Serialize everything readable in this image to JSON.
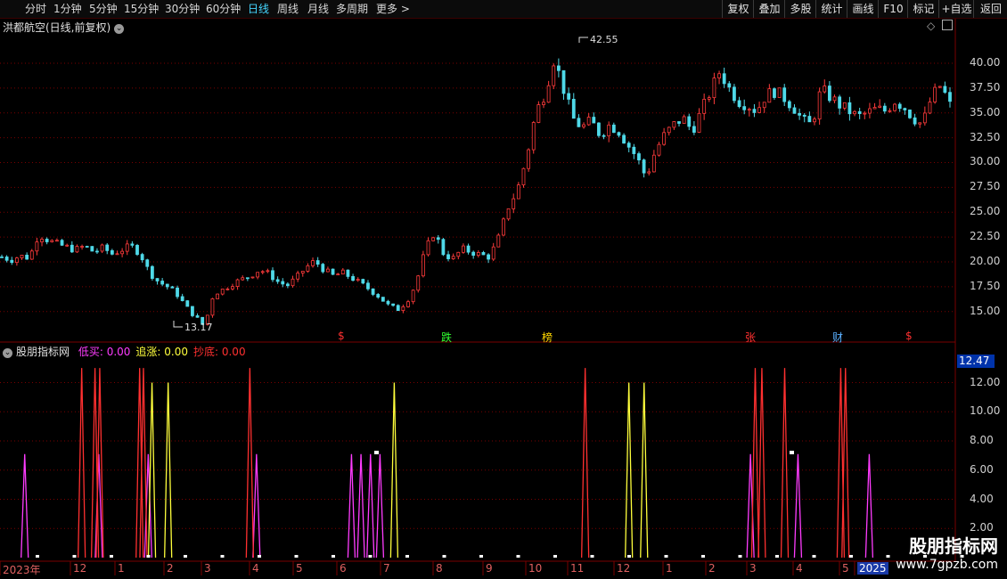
{
  "toolbar": {
    "periods": [
      {
        "label": "分时",
        "active": false
      },
      {
        "label": "1分钟",
        "active": false
      },
      {
        "label": "5分钟",
        "active": false
      },
      {
        "label": "15分钟",
        "active": false
      },
      {
        "label": "30分钟",
        "active": false
      },
      {
        "label": "60分钟",
        "active": false
      },
      {
        "label": "日线",
        "active": true
      },
      {
        "label": "周线",
        "active": false
      },
      {
        "label": "月线",
        "active": false
      },
      {
        "label": "多周期",
        "active": false
      }
    ],
    "more_label": "更多",
    "more_arrow": ">",
    "buttons": [
      "复权",
      "叠加",
      "多股",
      "统计",
      "画线",
      "F10",
      "标记",
      "+自选",
      "返回"
    ]
  },
  "main": {
    "title": "洪都航空(日线,前复权)",
    "high_label": "42.55",
    "low_label": "13.17",
    "yaxis_ticks": [
      "40.00",
      "37.50",
      "35.00",
      "32.50",
      "30.00",
      "27.50",
      "25.00",
      "22.50",
      "20.00",
      "17.50",
      "15.00"
    ],
    "markers": [
      {
        "text": "$",
        "color": "#ff3030"
      },
      {
        "text": "跌",
        "color": "#30ff30"
      },
      {
        "text": "榜",
        "color": "#ffd700"
      },
      {
        "text": "张",
        "color": "#ff3030"
      },
      {
        "text": "财",
        "color": "#5ab0ff"
      },
      {
        "text": "$",
        "color": "#ff3030"
      }
    ]
  },
  "indicator": {
    "name": "股朋指标网",
    "items": [
      {
        "label": "低买:",
        "value": "0.00",
        "color": "#ff3cff"
      },
      {
        "label": "追涨:",
        "value": "0.00",
        "color": "#ffff3c"
      },
      {
        "label": "抄底:",
        "value": "0.00",
        "color": "#ff3030"
      }
    ],
    "current_value": "12.47",
    "yaxis_ticks": [
      "12.00",
      "10.00",
      "8.00",
      "6.00",
      "4.00",
      "2.00"
    ]
  },
  "xaxis": {
    "labels": [
      "2023年",
      "12",
      "1",
      "2",
      "3",
      "4",
      "5",
      "6",
      "7",
      "8",
      "9",
      "10",
      "11",
      "12",
      "1",
      "2",
      "3",
      "4",
      "5",
      "2025"
    ]
  },
  "watermark": {
    "title": "股朋指标网",
    "url": "www.7gpzb.com"
  },
  "colors": {
    "up": "#ff3b3b",
    "down": "#4fd9e8",
    "grid": "#7a0000"
  },
  "chart_data": [
    {
      "type": "candlestick",
      "title": "洪都航空(日线,前复权)",
      "ylim": [
        13,
        42.6
      ],
      "yticks": [
        15,
        17.5,
        20,
        22.5,
        25,
        27.5,
        30,
        32.5,
        35,
        37.5,
        40
      ],
      "annotations": {
        "high": 42.55,
        "low": 13.17
      },
      "close_path": [
        20.5,
        20.2,
        20.6,
        20.4,
        22.8,
        22.2,
        21.8,
        21.5,
        21.2,
        21.6,
        21.0,
        21.4,
        20.8,
        21.2,
        21.6,
        20.9,
        19.0,
        18.0,
        17.5,
        16.8,
        15.5,
        14.5,
        13.5,
        16.8,
        17.2,
        17.8,
        18.2,
        18.6,
        19.2,
        18.8,
        18.0,
        17.6,
        18.4,
        19.4,
        20.1,
        19.2,
        18.6,
        18.9,
        18.4,
        17.8,
        17.2,
        16.5,
        15.6,
        15.2,
        16.0,
        17.8,
        21.2,
        23.0,
        20.8,
        20.3,
        21.3,
        21.0,
        20.7,
        20.5,
        22.5,
        25.5,
        27.2,
        30.5,
        35.0,
        37.0,
        40.5,
        37.5,
        34.5,
        33.5,
        34.2,
        32.8,
        33.8,
        33.2,
        31.8,
        30.5,
        28.5,
        31.2,
        32.8,
        33.8,
        34.5,
        33.2,
        35.2,
        37.2,
        39.2,
        37.5,
        36.2,
        35.8,
        35.2,
        36.8,
        37.2,
        36.5,
        35.6,
        34.2,
        33.8,
        37.4,
        36.6,
        35.8,
        35.2,
        34.6,
        35.0,
        35.4,
        35.2,
        36.2,
        35.6,
        34.5,
        33.8,
        36.6,
        37.8,
        35.8
      ]
    },
    {
      "type": "line",
      "title": "股朋指标网",
      "ylim": [
        0,
        13.5
      ],
      "yticks": [
        2,
        4,
        6,
        8,
        10,
        12
      ],
      "series": [
        {
          "name": "低买",
          "color": "#ff3cff",
          "spikes": [
            [
              0.026,
              7.1
            ],
            [
              0.104,
              7.1
            ],
            [
              0.156,
              7.1
            ],
            [
              0.27,
              7.1
            ],
            [
              0.37,
              7.1
            ],
            [
              0.38,
              7.1
            ],
            [
              0.39,
              7.1
            ],
            [
              0.4,
              7.1
            ],
            [
              0.79,
              7.1
            ],
            [
              0.84,
              7.1
            ],
            [
              0.915,
              7.1
            ]
          ]
        },
        {
          "name": "追涨",
          "color": "#ffff3c",
          "spikes": [
            [
              0.16,
              12.0
            ],
            [
              0.177,
              12.0
            ],
            [
              0.415,
              12.0
            ],
            [
              0.662,
              12.0
            ],
            [
              0.678,
              12.0
            ]
          ]
        },
        {
          "name": "抄底",
          "color": "#ff3030",
          "spikes": [
            [
              0.086,
              13.0
            ],
            [
              0.1,
              13.0
            ],
            [
              0.105,
              13.0
            ],
            [
              0.147,
              13.0
            ],
            [
              0.151,
              13.0
            ],
            [
              0.263,
              13.0
            ],
            [
              0.616,
              13.0
            ],
            [
              0.795,
              13.0
            ],
            [
              0.802,
              13.0
            ],
            [
              0.826,
              13.0
            ],
            [
              0.885,
              13.0
            ],
            [
              0.89,
              13.0
            ]
          ]
        }
      ],
      "current_value": 12.47
    }
  ]
}
